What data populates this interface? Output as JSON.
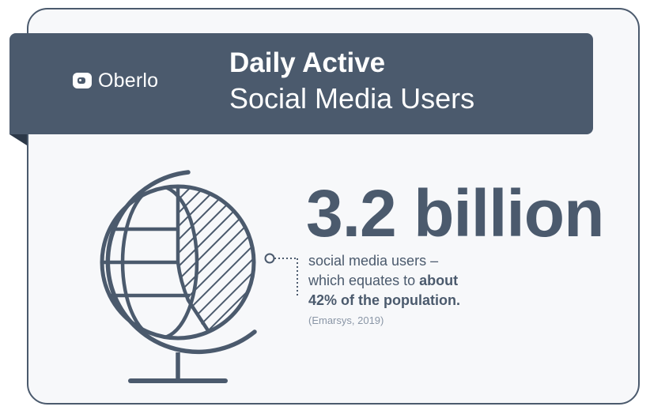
{
  "brand": {
    "logo_text": "Oberlo"
  },
  "header": {
    "title_line1": "Daily Active",
    "title_line2": "Social Media Users"
  },
  "stat": {
    "value": "3.2 billion",
    "desc_line1": "social media users –",
    "desc_line2_plain": "which equates to ",
    "desc_line2_bold": "about",
    "desc_line3_bold": "42% of the population."
  },
  "source": "(Emarsys, 2019)",
  "colors": {
    "primary": "#4b5a6d",
    "background": "#f7f8fa",
    "text_light": "#ffffff",
    "muted": "#8a96a6"
  }
}
